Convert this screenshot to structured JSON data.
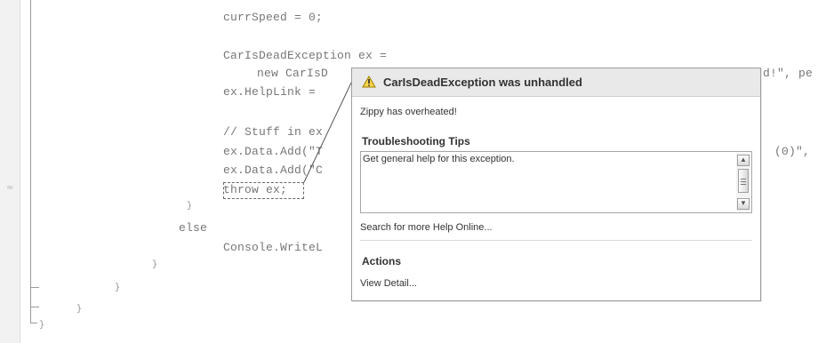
{
  "editor": {
    "code_lines": [
      "currSpeed = 0;",
      "CarIsDeadException ex =",
      "new CarIsD",
      "ex.HelpLink =",
      "// Stuff in ex",
      "ex.Data.Add(\"T",
      "ex.Data.Add(\"C",
      "throw ex;",
      "}",
      "else",
      "Console.WriteL",
      "}",
      "}",
      "}",
      "}"
    ],
    "right_fragments": [
      "d!\", pe",
      "(0)\","
    ],
    "margin_symbol": "≈"
  },
  "exception_popup": {
    "title": "CarIsDeadException was unhandled",
    "message": "Zippy has overheated!",
    "troubleshooting": {
      "heading": "Troubleshooting Tips",
      "tip": "Get general help for this exception.",
      "search_link": "Search for more Help Online..."
    },
    "actions": {
      "heading": "Actions",
      "view_detail": "View Detail..."
    },
    "icon": "warning-icon",
    "header_color": "#e9e9e9",
    "border_color": "#9c9c9c"
  }
}
